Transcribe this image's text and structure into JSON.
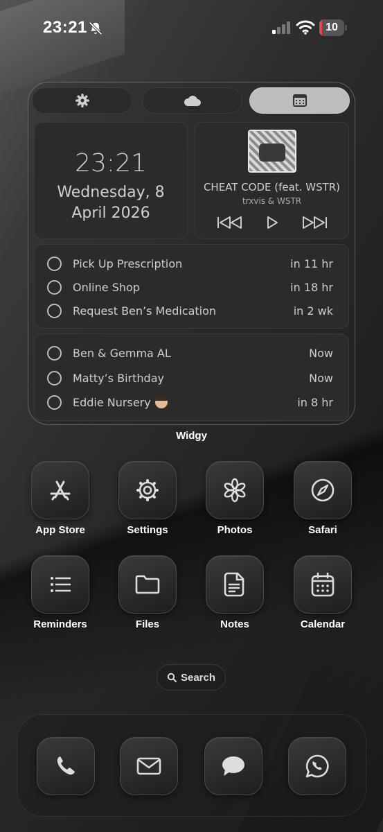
{
  "status_bar": {
    "time": "23:21",
    "battery": "10",
    "battery_level": 0.1,
    "icons": [
      "bell-slash-icon",
      "cellular-signal-icon",
      "wifi-icon",
      "battery-icon"
    ]
  },
  "widget": {
    "name": "Widgy",
    "tabs": [
      {
        "icon": "gear-icon"
      },
      {
        "icon": "cloud-icon"
      },
      {
        "icon": "calendar-grid-icon",
        "active": true
      }
    ],
    "clock": {
      "time": "23:21",
      "date_line1": "Wednesday, 8",
      "date_line2": "April 2026"
    },
    "music": {
      "song": "CHEAT CODE (feat. WSTR)",
      "artist": "trxvis & WSTR",
      "controls": [
        "previous-icon",
        "play-icon",
        "next-icon"
      ]
    },
    "reminders": [
      {
        "title": "Pick Up Prescription",
        "due": "in 11 hr"
      },
      {
        "title": "Online Shop",
        "due": "in 18 hr"
      },
      {
        "title": "Request Ben’s Medication",
        "due": "in 2 wk"
      }
    ],
    "events": [
      {
        "title": "Ben & Gemma AL",
        "due": "Now"
      },
      {
        "title": "Matty’s Birthday",
        "due": "Now"
      },
      {
        "title": "Eddie Nursery",
        "due": "in 8 hr",
        "emoji": "boy-emoji"
      }
    ]
  },
  "apps": [
    {
      "label": "App Store",
      "icon": "app-store-icon"
    },
    {
      "label": "Settings",
      "icon": "gear-icon"
    },
    {
      "label": "Photos",
      "icon": "flower-icon"
    },
    {
      "label": "Safari",
      "icon": "compass-icon"
    },
    {
      "label": "Reminders",
      "icon": "list-icon"
    },
    {
      "label": "Files",
      "icon": "folder-icon"
    },
    {
      "label": "Notes",
      "icon": "note-icon"
    },
    {
      "label": "Calendar",
      "icon": "calendar-icon"
    }
  ],
  "search": {
    "label": "Search",
    "icon": "search-icon"
  },
  "dock": [
    {
      "icon": "phone-icon"
    },
    {
      "icon": "mail-icon"
    },
    {
      "icon": "message-icon"
    },
    {
      "icon": "whatsapp-icon"
    }
  ],
  "colors": {
    "battery_fill": "#e5484d",
    "active_tab": "#bdbdbd"
  }
}
